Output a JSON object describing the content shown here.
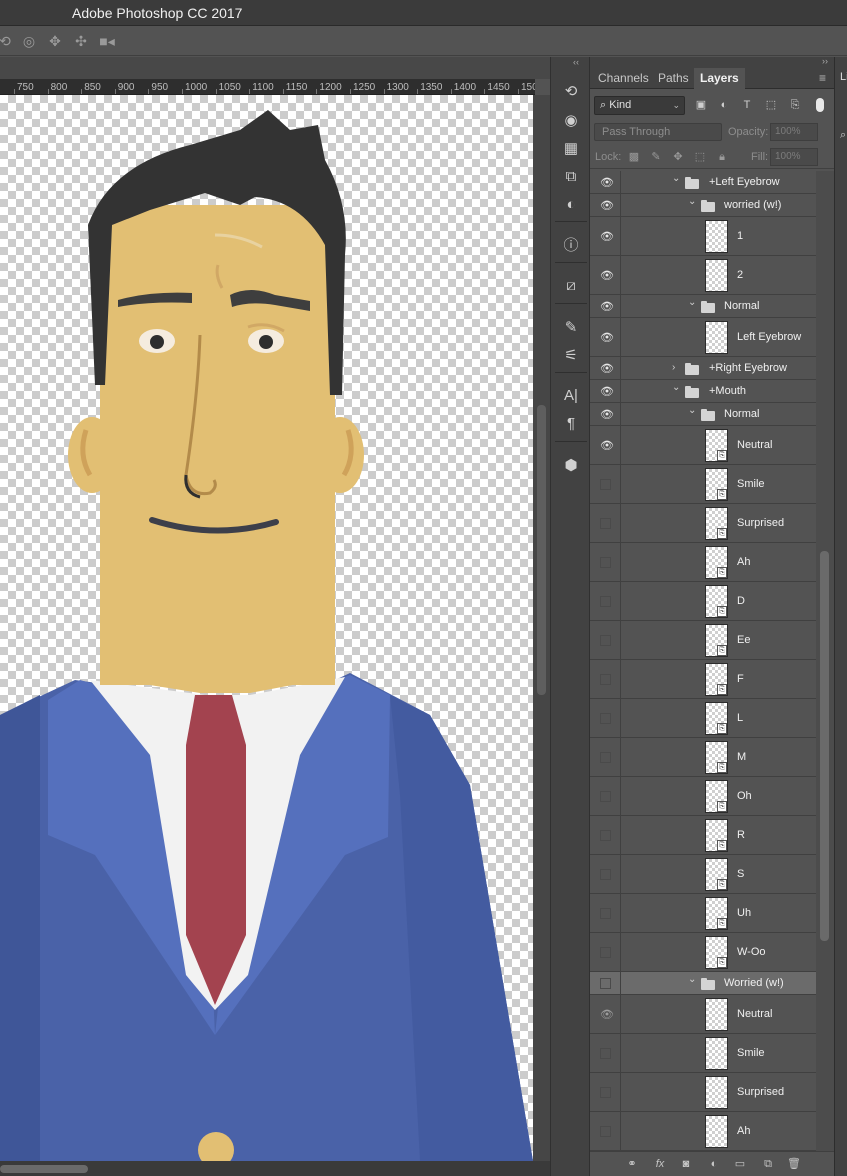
{
  "window": {
    "title": "Adobe Photoshop CC 2017"
  },
  "options_bar": {
    "icons": [
      "3d-rotate-icon",
      "3d-roll-icon",
      "3d-pan-icon",
      "3d-slide-icon",
      "3d-camera-icon"
    ]
  },
  "ruler": {
    "ticks": [
      "750",
      "800",
      "850",
      "900",
      "950",
      "1000",
      "1050",
      "1100",
      "1150",
      "1200",
      "1250",
      "1300",
      "1350",
      "1400",
      "1450",
      "150"
    ]
  },
  "tools_panel": {
    "icons": [
      "history-icon",
      "color-palette-icon",
      "swatches-icon",
      "libraries-icon",
      "adjustments-icon",
      "info-icon",
      "properties-icon",
      "brush-icon",
      "brush-presets-icon",
      "character-icon",
      "paragraph-icon",
      "3d-icon"
    ]
  },
  "panel": {
    "tabs": [
      "Channels",
      "Paths",
      "Layers"
    ],
    "active_tab": "Layers",
    "filter": {
      "kind_label": "Kind"
    },
    "blend_mode": "Pass Through",
    "opacity_label": "Opacity:",
    "opacity_value": "100%",
    "lock_label": "Lock:",
    "fill_label": "Fill:",
    "fill_value": "100%",
    "right_strip_label": "Li"
  },
  "layers": [
    {
      "name": "+Left Eyebrow",
      "type": "group",
      "expanded": true,
      "visible": true
    },
    {
      "name": "worried (w!)",
      "type": "group",
      "expanded": true,
      "visible": true
    },
    {
      "name": "1",
      "type": "layer",
      "visible": true
    },
    {
      "name": "2",
      "type": "layer",
      "visible": true
    },
    {
      "name": "Normal",
      "type": "group",
      "expanded": true,
      "visible": true
    },
    {
      "name": "Left Eyebrow",
      "type": "layer",
      "visible": true
    },
    {
      "name": "+Right Eyebrow",
      "type": "group",
      "expanded": false,
      "visible": true
    },
    {
      "name": "+Mouth",
      "type": "group",
      "expanded": true,
      "visible": true
    },
    {
      "name": "Normal",
      "type": "group",
      "expanded": true,
      "visible": true
    },
    {
      "name": "Neutral",
      "type": "smart",
      "visible": true
    },
    {
      "name": "Smile",
      "type": "smart",
      "visible": false
    },
    {
      "name": "Surprised",
      "type": "smart",
      "visible": false
    },
    {
      "name": "Ah",
      "type": "smart",
      "visible": false
    },
    {
      "name": "D",
      "type": "smart",
      "visible": false
    },
    {
      "name": "Ee",
      "type": "smart",
      "visible": false
    },
    {
      "name": "F",
      "type": "smart",
      "visible": false
    },
    {
      "name": "L",
      "type": "smart",
      "visible": false
    },
    {
      "name": "M",
      "type": "smart",
      "visible": false
    },
    {
      "name": "Oh",
      "type": "smart",
      "visible": false
    },
    {
      "name": "R",
      "type": "smart",
      "visible": false
    },
    {
      "name": "S",
      "type": "smart",
      "visible": false
    },
    {
      "name": "Uh",
      "type": "smart",
      "visible": false
    },
    {
      "name": "W-Oo",
      "type": "smart",
      "visible": false
    },
    {
      "name": "Worried (w!)",
      "type": "group",
      "expanded": true,
      "visible": false,
      "selected": true
    },
    {
      "name": "Neutral",
      "type": "layer",
      "visible": true,
      "dim": true
    },
    {
      "name": "Smile",
      "type": "layer",
      "visible": false
    },
    {
      "name": "Surprised",
      "type": "layer",
      "visible": false
    },
    {
      "name": "Ah",
      "type": "layer",
      "visible": false
    }
  ],
  "colors": {
    "skin": "#e2bf73",
    "hair": "#333333",
    "suit": "#4a62a8",
    "tie": "#a3434f",
    "shirt": "#f2f2f2"
  }
}
